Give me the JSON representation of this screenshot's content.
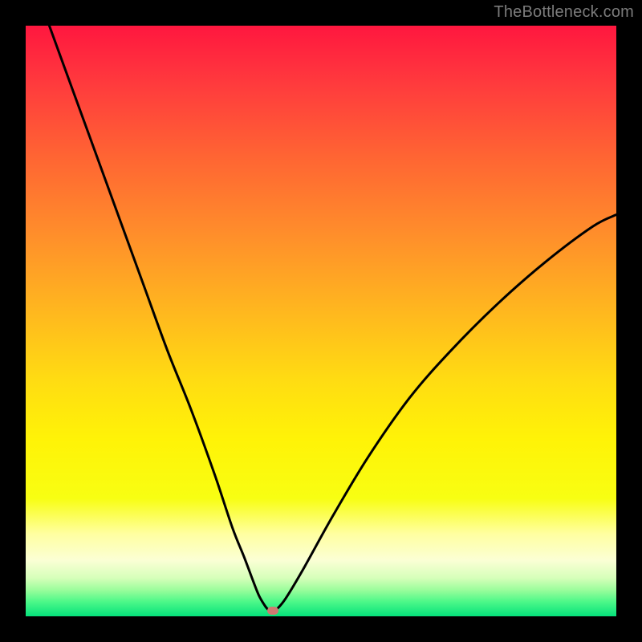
{
  "attribution": "TheBottleneck.com",
  "colors": {
    "frame": "#000000",
    "marker": "#cf7a72",
    "curve": "#000000",
    "gradient_stops": [
      {
        "offset": 0.0,
        "color": "#ff173f"
      },
      {
        "offset": 0.1,
        "color": "#ff3b3d"
      },
      {
        "offset": 0.22,
        "color": "#ff6433"
      },
      {
        "offset": 0.35,
        "color": "#ff8d2b"
      },
      {
        "offset": 0.48,
        "color": "#ffb61f"
      },
      {
        "offset": 0.6,
        "color": "#ffdc12"
      },
      {
        "offset": 0.7,
        "color": "#fff307"
      },
      {
        "offset": 0.8,
        "color": "#f8fe12"
      },
      {
        "offset": 0.86,
        "color": "#ffffa0"
      },
      {
        "offset": 0.905,
        "color": "#fbffd5"
      },
      {
        "offset": 0.935,
        "color": "#d6ffba"
      },
      {
        "offset": 0.955,
        "color": "#9cfd9c"
      },
      {
        "offset": 0.975,
        "color": "#4ef889"
      },
      {
        "offset": 1.0,
        "color": "#05e27b"
      }
    ]
  },
  "chart_data": {
    "type": "line",
    "title": "",
    "xlabel": "",
    "ylabel": "",
    "xlim": [
      0,
      100
    ],
    "ylim": [
      0,
      100
    ],
    "grid": false,
    "series": [
      {
        "name": "bottleneck-curve",
        "x": [
          4,
          8,
          12,
          16,
          20,
          24,
          28,
          32,
          35,
          37,
          38.5,
          39.5,
          40.5,
          41,
          41.5,
          42,
          42.5,
          44,
          47,
          52,
          58,
          65,
          72,
          80,
          88,
          96,
          100
        ],
        "y": [
          100,
          89,
          78,
          67,
          56,
          45,
          35,
          24,
          15,
          10,
          6,
          3.5,
          1.8,
          1.2,
          1.0,
          1.0,
          1.2,
          3,
          8,
          17,
          27,
          37,
          45,
          53,
          60,
          66,
          68
        ]
      }
    ],
    "marker": {
      "x": 41.8,
      "y": 1.0,
      "name": "optimal-point"
    }
  }
}
